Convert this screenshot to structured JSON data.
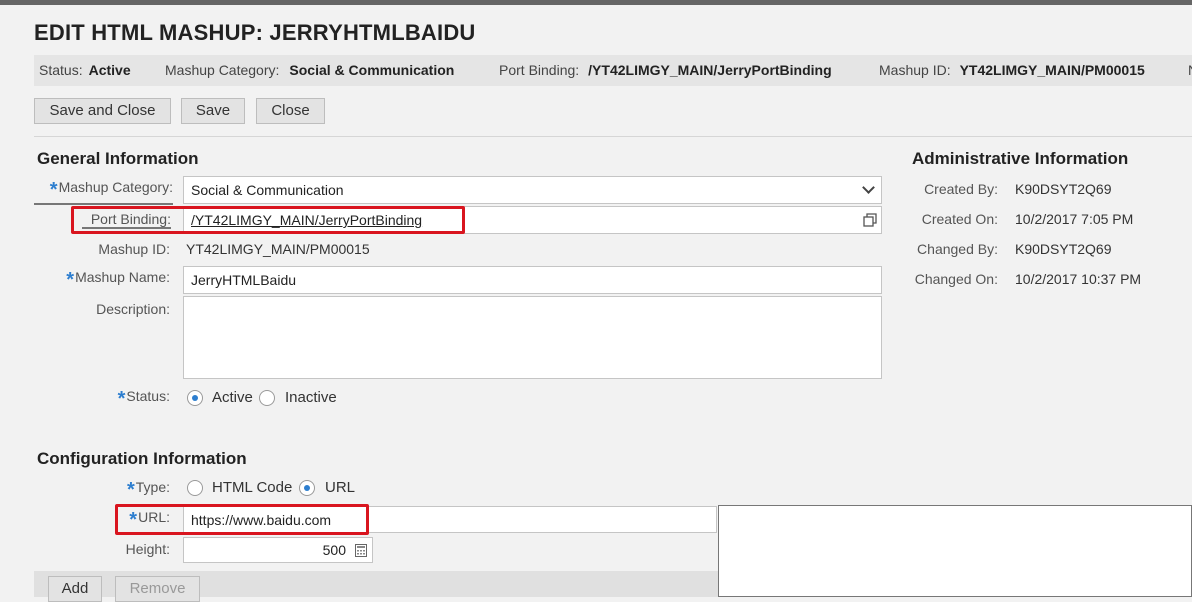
{
  "header": {
    "title": "EDIT HTML MASHUP: JERRYHTMLBAIDU"
  },
  "status_bar": {
    "status_label": "Status:",
    "status_value": "Active",
    "category_label": "Mashup Category:",
    "category_value": "Social & Communication",
    "port_label": "Port Binding:",
    "port_value": "/YT42LIMGY_MAIN/JerryPortBinding",
    "id_label": "Mashup ID:",
    "id_value": "YT42LIMGY_MAIN/PM00015",
    "overflow": "N"
  },
  "toolbar": {
    "save_close": "Save and Close",
    "save": "Save",
    "close": "Close"
  },
  "general": {
    "title": "General Information",
    "category_label": "Mashup Category:",
    "category_value": "Social & Communication",
    "port_label": "Port Binding:",
    "port_value": "/YT42LIMGY_MAIN/JerryPortBinding",
    "id_label": "Mashup ID:",
    "id_value": "YT42LIMGY_MAIN/PM00015",
    "name_label": "Mashup Name:",
    "name_value": "JerryHTMLBaidu",
    "desc_label": "Description:",
    "desc_value": "",
    "status_label": "Status:",
    "status_active": "Active",
    "status_inactive": "Inactive"
  },
  "admin": {
    "title": "Administrative Information",
    "created_by_label": "Created By:",
    "created_by": "K90DSYT2Q69",
    "created_on_label": "Created On:",
    "created_on": "10/2/2017 7:05 PM",
    "changed_by_label": "Changed By:",
    "changed_by": "K90DSYT2Q69",
    "changed_on_label": "Changed On:",
    "changed_on": "10/2/2017 10:37 PM"
  },
  "config": {
    "title": "Configuration Information",
    "type_label": "Type:",
    "type_html": "HTML Code",
    "type_url": "URL",
    "url_label": "URL:",
    "url_value": "https://www.baidu.com",
    "height_label": "Height:",
    "height_value": "500"
  },
  "footer": {
    "add": "Add",
    "remove": "Remove"
  },
  "colors": {
    "highlight": "#d9151f",
    "required": "#2d7ecf"
  }
}
